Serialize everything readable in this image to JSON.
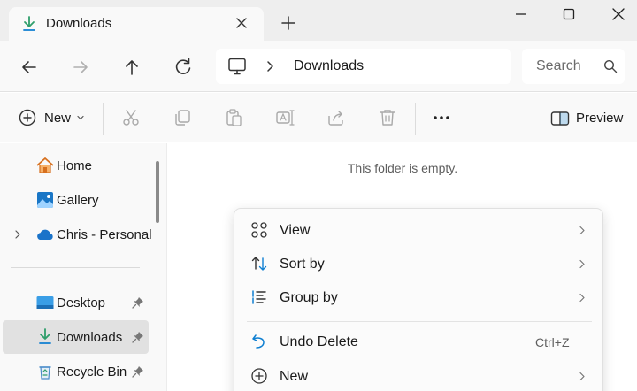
{
  "colors": {
    "accent": "#0f7fd1",
    "download_green": "#2f9e6b",
    "icon_muted": "#a9a9a9"
  },
  "tab": {
    "icon": "download-icon",
    "title": "Downloads",
    "close_icon": "close-icon"
  },
  "window": {
    "new_tab_icon": "plus-icon",
    "minimize_icon": "minimize-icon",
    "maximize_icon": "maximize-icon",
    "close_icon": "close-icon"
  },
  "nav": {
    "back_icon": "arrow-left-icon",
    "forward_icon": "arrow-right-icon",
    "up_icon": "arrow-up-icon",
    "refresh_icon": "refresh-icon",
    "address": {
      "location_icon": "this-pc-icon",
      "separator_icon": "chevron-right-icon",
      "crumb": "Downloads"
    },
    "search": {
      "placeholder": "Search",
      "icon": "search-icon"
    }
  },
  "command_bar": {
    "new_label": "New",
    "new_icon": "plus-circle-icon",
    "tools": [
      "cut-icon",
      "copy-icon",
      "paste-icon",
      "rename-icon",
      "share-icon",
      "delete-icon"
    ],
    "more_icon": "more-icon",
    "preview_label": "Preview",
    "preview_icon": "preview-pane-icon"
  },
  "sidebar": {
    "items": [
      {
        "label": "Home",
        "icon": "home-icon"
      },
      {
        "label": "Gallery",
        "icon": "gallery-icon"
      },
      {
        "label": "Chris - Personal",
        "icon": "onedrive-cloud-icon",
        "expandable": true
      },
      {
        "label": "Desktop",
        "icon": "desktop-icon",
        "pinned": true
      },
      {
        "label": "Downloads",
        "icon": "download-icon",
        "pinned": true,
        "selected": true
      },
      {
        "label": "Recycle Bin",
        "icon": "recycle-bin-icon",
        "pinned": true
      }
    ]
  },
  "content": {
    "empty_message": "This folder is empty."
  },
  "context_menu": {
    "items": [
      {
        "label": "View",
        "icon": "view-grid-icon",
        "submenu": true
      },
      {
        "label": "Sort by",
        "icon": "sort-icon",
        "submenu": true
      },
      {
        "label": "Group by",
        "icon": "group-by-icon",
        "submenu": true
      },
      {
        "label": "Undo Delete",
        "icon": "undo-icon",
        "shortcut": "Ctrl+Z"
      },
      {
        "label": "New",
        "icon": "plus-circle-icon",
        "submenu": true
      }
    ]
  }
}
